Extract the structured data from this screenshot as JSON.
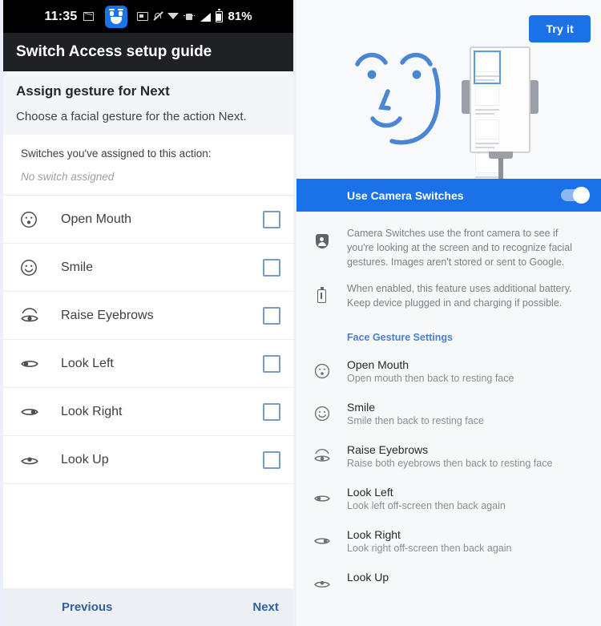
{
  "left": {
    "status_bar": {
      "time": "11:35",
      "battery_percent": "81%",
      "icons": [
        "message-icon",
        "face-badge-icon",
        "cast-icon",
        "bell-muted-icon",
        "wifi-icon",
        "vibrate-icon",
        "signal-icon",
        "battery-icon"
      ]
    },
    "app_bar": {
      "title": "Switch Access setup guide"
    },
    "intro": {
      "title": "Assign gesture for Next",
      "subtitle": "Choose a facial gesture for the action Next."
    },
    "assigned": {
      "label": "Switches you've assigned to this action:",
      "value": "No switch assigned"
    },
    "gestures": [
      {
        "label": "Open Mouth",
        "icon": "open-mouth-icon",
        "checked": false
      },
      {
        "label": "Smile",
        "icon": "smile-icon",
        "checked": false
      },
      {
        "label": "Raise Eyebrows",
        "icon": "raise-eyebrows-icon",
        "checked": false
      },
      {
        "label": "Look Left",
        "icon": "look-left-icon",
        "checked": false
      },
      {
        "label": "Look Right",
        "icon": "look-right-icon",
        "checked": false
      },
      {
        "label": "Look Up",
        "icon": "look-up-icon",
        "checked": false
      }
    ],
    "footer": {
      "previous": "Previous",
      "next": "Next"
    }
  },
  "right": {
    "hero": {
      "try_it": "Try it",
      "illustration": "face-and-phone-on-stand-illustration"
    },
    "toggle": {
      "label": "Use Camera Switches",
      "state": "on"
    },
    "info": [
      {
        "icon": "privacy-shield-icon",
        "text": "Camera Switches use the front camera to see if you're looking at the screen and to recognize facial gestures. Images aren't stored or sent to Google."
      },
      {
        "icon": "battery-icon",
        "text": "When enabled, this feature uses additional battery. Keep device plugged in and charging if possible."
      }
    ],
    "section_header": "Face Gesture Settings",
    "gesture_settings": [
      {
        "title": "Open Mouth",
        "desc": "Open mouth then back to resting face",
        "icon": "open-mouth-icon"
      },
      {
        "title": "Smile",
        "desc": "Smile then back to resting face",
        "icon": "smile-icon"
      },
      {
        "title": "Raise Eyebrows",
        "desc": "Raise both eyebrows then back to resting face",
        "icon": "raise-eyebrows-icon"
      },
      {
        "title": "Look Left",
        "desc": "Look left off-screen then back again",
        "icon": "look-left-icon"
      },
      {
        "title": "Look Right",
        "desc": "Look right off-screen then back again",
        "icon": "look-right-icon"
      },
      {
        "title": "Look Up",
        "desc": "",
        "icon": "look-up-icon"
      }
    ]
  },
  "colors": {
    "accent_blue": "#1b72e8",
    "app_bar": "#202124",
    "link_blue": "#31609c",
    "section_blue": "#4a7fc9",
    "face_art_blue": "#4a86d4"
  }
}
